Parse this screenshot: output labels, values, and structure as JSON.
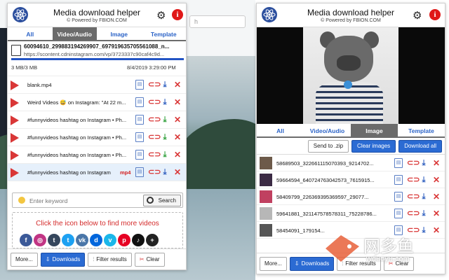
{
  "background": {
    "address_hint": "h"
  },
  "left_panel": {
    "title": "Media download helper",
    "subtitle": "© Powered by FBION.COM",
    "tabs": [
      {
        "label": "All"
      },
      {
        "label": "Video/Audio"
      },
      {
        "label": "Image"
      },
      {
        "label": "Template"
      }
    ],
    "file": {
      "name": "60094610_299883194269907_697919635705561088_n...",
      "url": "https://scontent.cdninstagram.com/vp/3723337c90caf4c9d...",
      "size": "3 MB/3 MB",
      "date": "8/4/2019 3:29:00 PM",
      "progress": 1.0
    },
    "rows": [
      {
        "text": "blank.mp4",
        "badge": ""
      },
      {
        "text": "Weird Videos 😅 on Instagram: \"At 22 m...",
        "badge": ""
      },
      {
        "text": "#funnyvideos hashtag on Instagram • Ph...",
        "badge": ""
      },
      {
        "text": "#funnyvideos hashtag on Instagram • Ph...",
        "badge": ""
      },
      {
        "text": "#funnyvideos hashtag on Instagram • Ph...",
        "badge": ""
      },
      {
        "text": "#funnyvideos hashtag on Instagram",
        "badge": "mp4"
      }
    ],
    "search": {
      "placeholder": "Enter keyword",
      "button": "Search"
    },
    "promo_text": "Click the icon below to find more videos",
    "social": [
      {
        "name": "facebook-icon",
        "glyph": "f",
        "color": "#3b5998"
      },
      {
        "name": "instagram-icon",
        "glyph": "◎",
        "color": "#c13584"
      },
      {
        "name": "tumblr-icon",
        "glyph": "t",
        "color": "#35465c"
      },
      {
        "name": "twitter-icon",
        "glyph": "t",
        "color": "#1da1f2"
      },
      {
        "name": "vk-icon",
        "glyph": "vk",
        "color": "#4a76a8"
      },
      {
        "name": "dailymotion-icon",
        "glyph": "d",
        "color": "#0066dc"
      },
      {
        "name": "vimeo-icon",
        "glyph": "v",
        "color": "#1ab7ea"
      },
      {
        "name": "pinterest-icon",
        "glyph": "p",
        "color": "#e60023"
      },
      {
        "name": "tiktok-icon",
        "glyph": "♪",
        "color": "#111111"
      },
      {
        "name": "more-sites-icon",
        "glyph": "+",
        "color": "#222222"
      }
    ],
    "footer": {
      "more": "More...",
      "downloads": "Downloads",
      "filter": "Filter results",
      "clear": "Clear"
    }
  },
  "right_panel": {
    "title": "Media download helper",
    "subtitle": "© Powered by FBION.COM",
    "tabs": [
      {
        "label": "All"
      },
      {
        "label": "Video/Audio"
      },
      {
        "label": "Image"
      },
      {
        "label": "Template"
      }
    ],
    "actions": {
      "send_zip": "Send to .zip",
      "clear_images": "Clear images",
      "download_all": "Download all"
    },
    "rows": [
      {
        "text": "58689503_322661115070393_9214702..."
      },
      {
        "text": "59664594_640724763042573_7615915..."
      },
      {
        "text": "58409799_226369395369597_29077..."
      },
      {
        "text": "59641881_321147578578311_75228786..."
      },
      {
        "text": "58454091_179154..."
      }
    ],
    "footer": {
      "more": "More...",
      "downloads": "Downloads",
      "filter": "Filter results",
      "clear": "Clear"
    }
  },
  "watermark": {
    "brand": "网多鱼",
    "domain": "wduoyu.com"
  },
  "colors": {
    "accent_blue": "#2b6bd3",
    "accent_red": "#d93737",
    "tab_active": "#6b6b6b"
  }
}
